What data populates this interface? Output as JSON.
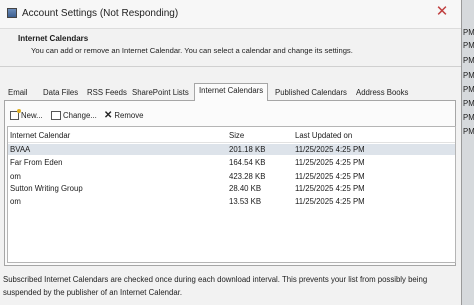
{
  "window": {
    "title": "Account Settings (Not Responding)",
    "close_glyph": "✕"
  },
  "header": {
    "title": "Internet Calendars",
    "description": "You can add or remove an Internet Calendar. You can select a calendar and change its settings."
  },
  "tabs": [
    {
      "label": "Email",
      "active": false
    },
    {
      "label": "Data Files",
      "active": false
    },
    {
      "label": "RSS Feeds",
      "active": false
    },
    {
      "label": "SharePoint Lists",
      "active": false
    },
    {
      "label": "Internet Calendars",
      "active": true
    },
    {
      "label": "Published Calendars",
      "active": false
    },
    {
      "label": "Address Books",
      "active": false
    }
  ],
  "toolbar": {
    "new_label": "New...",
    "change_label": "Change...",
    "remove_label": "Remove"
  },
  "list": {
    "columns": [
      "Internet Calendar",
      "Size",
      "Last Updated on"
    ],
    "rows": [
      {
        "name": "BVAA",
        "size": "201.18 KB",
        "updated": "11/25/2025 4:25 PM",
        "selected": true
      },
      {
        "name": "Far From Eden",
        "size": "164.54 KB",
        "updated": "11/25/2025 4:25 PM",
        "selected": false
      },
      {
        "name": "om",
        "size": "423.28 KB",
        "updated": "11/25/2025 4:25 PM",
        "selected": false
      },
      {
        "name": "Sutton Writing Group",
        "size": "28.40 KB",
        "updated": "11/25/2025 4:25 PM",
        "selected": false
      },
      {
        "name": "om",
        "size": "13.53 KB",
        "updated": "11/25/2025 4:25 PM",
        "selected": false
      }
    ]
  },
  "footer": {
    "text": "Subscribed Internet Calendars are checked once during each download interval. This prevents your list from possibly being suspended by the publisher of an Internet Calendar."
  },
  "background_strip": [
    "PM",
    "PM",
    "PM",
    "PM",
    "PM",
    "PM",
    "PM",
    "PM"
  ]
}
